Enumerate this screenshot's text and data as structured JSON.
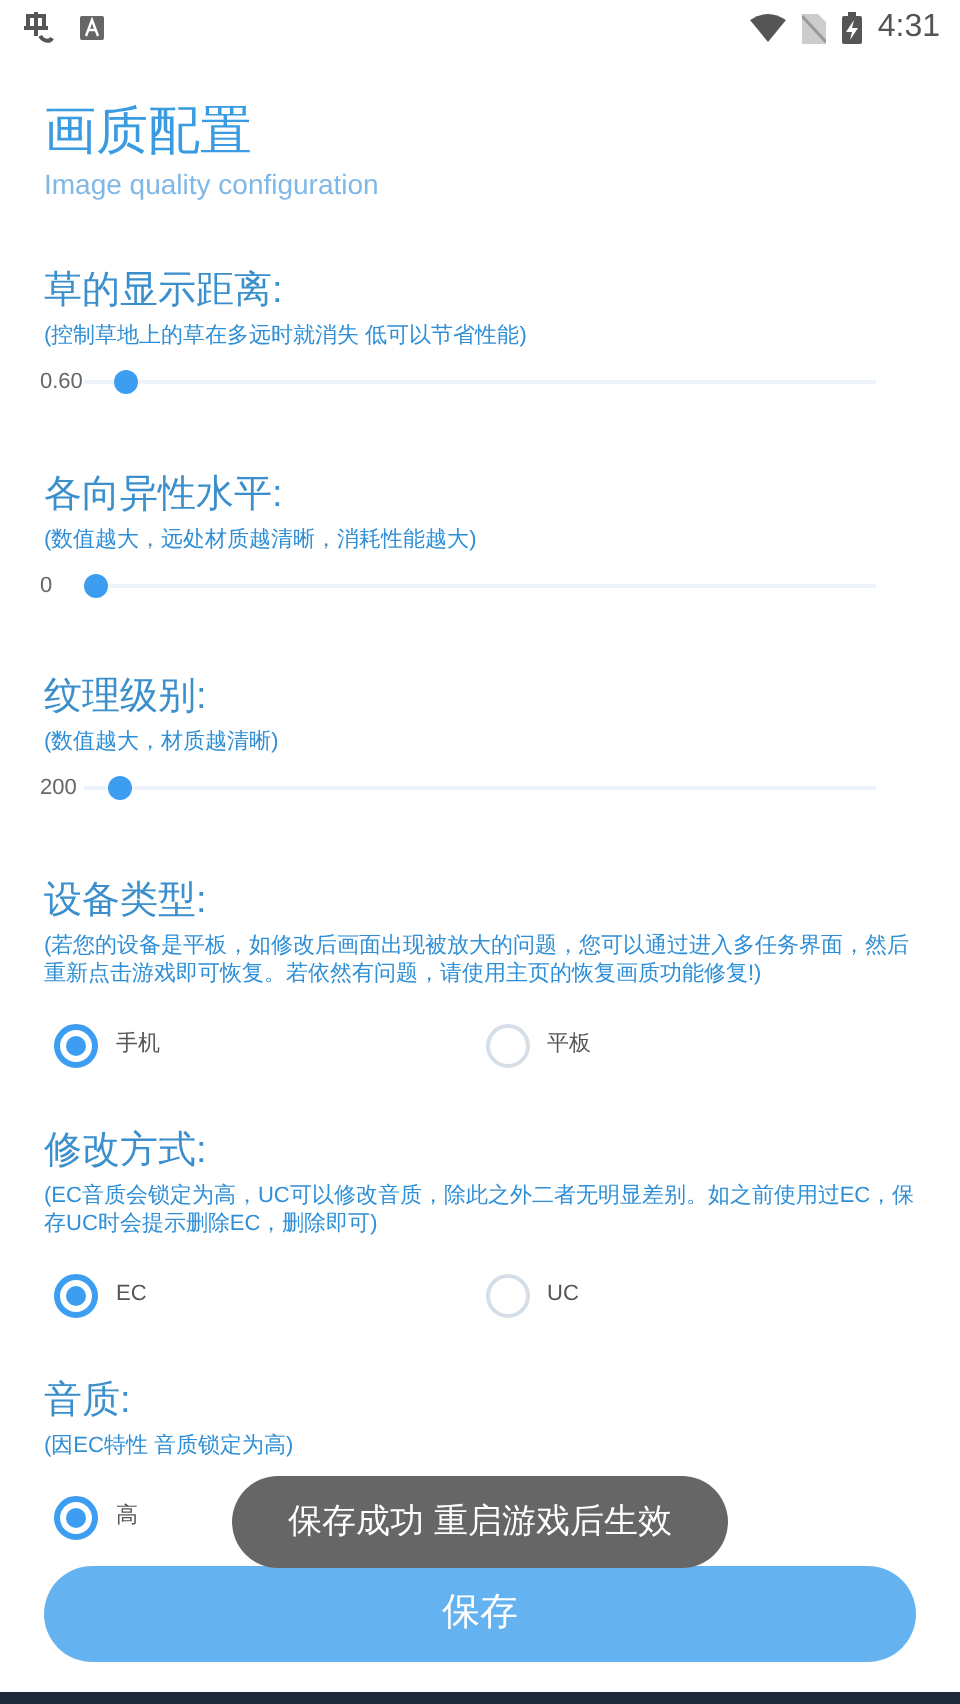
{
  "status_bar": {
    "time": "4:31"
  },
  "header": {
    "title": "画质配置",
    "subtitle": "Image quality configuration"
  },
  "sections": [
    {
      "kind": "slider",
      "title": "草的显示距离:",
      "hint": "(控制草地上的草在多远时就消失 低可以节省性能)",
      "reading": "0.60",
      "level": 0.04
    },
    {
      "kind": "slider",
      "title": "各向异性水平:",
      "hint": "(数值越大，远处材质越清晰，消耗性能越大)",
      "reading": "0",
      "level": 0
    },
    {
      "kind": "slider",
      "title": "纹理级别:",
      "hint": "(数值越大，材质越清晰)",
      "reading": "200",
      "level": 0.03
    },
    {
      "kind": "radio",
      "title": "设备类型:",
      "hint": "(若您的设备是平板，如修改后画面出现被放大的问题，您可以通过进入多任务界面，然后重新点击游戏即可恢复。若依然有问题，请使用主页的恢复画质功能修复!)",
      "options": [
        {
          "label": "手机",
          "selected": true
        },
        {
          "label": "平板",
          "selected": false
        }
      ]
    },
    {
      "kind": "radio",
      "title": "修改方式:",
      "hint": "(EC音质会锁定为高，UC可以修改音质，除此之外二者无明显差别。如之前使用过EC，保存UC时会提示删除EC，删除即可)",
      "options": [
        {
          "label": "EC",
          "selected": true
        },
        {
          "label": "UC",
          "selected": false
        }
      ]
    },
    {
      "kind": "radio",
      "title": "音质:",
      "hint": "(因EC特性 音质锁定为高)",
      "options": [
        {
          "label": "高",
          "selected": true
        }
      ]
    }
  ],
  "save_button": {
    "label": "保存"
  },
  "toast": {
    "text": "保存成功 重启游戏后生效"
  }
}
